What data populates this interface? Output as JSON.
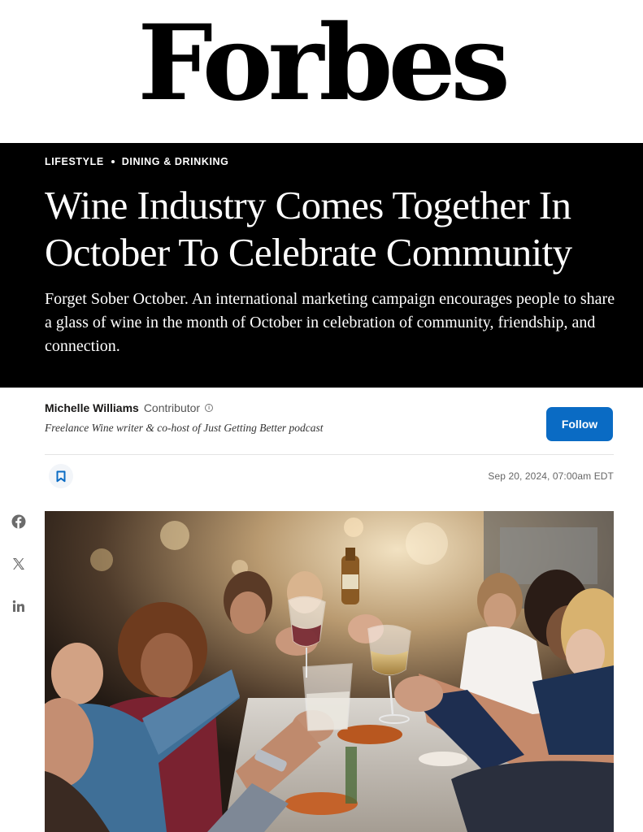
{
  "masthead": {
    "logo": "Forbes"
  },
  "hero": {
    "breadcrumbs": [
      "LIFESTYLE",
      "DINING & DRINKING"
    ],
    "headline": "Wine Industry Comes Together In October To Celebrate Community",
    "dek": "Forget Sober October. An international marketing campaign encourages people to share a glass of wine in the month of October in celebration of community, friendship, and connection."
  },
  "author": {
    "name": "Michelle Williams",
    "role": "Contributor",
    "bio": "Freelance Wine writer & co-host of Just Getting Better podcast",
    "follow_label": "Follow"
  },
  "meta": {
    "timestamp": "Sep 20, 2024, 07:00am EDT"
  },
  "share": {
    "icons": [
      "facebook-icon",
      "x-icon",
      "linkedin-icon"
    ]
  },
  "icons": {
    "bookmark": "bookmark-icon",
    "info": "info-icon"
  },
  "colors": {
    "accent": "#0a6bc4",
    "hero_bg": "#000000",
    "text": "#181716"
  }
}
